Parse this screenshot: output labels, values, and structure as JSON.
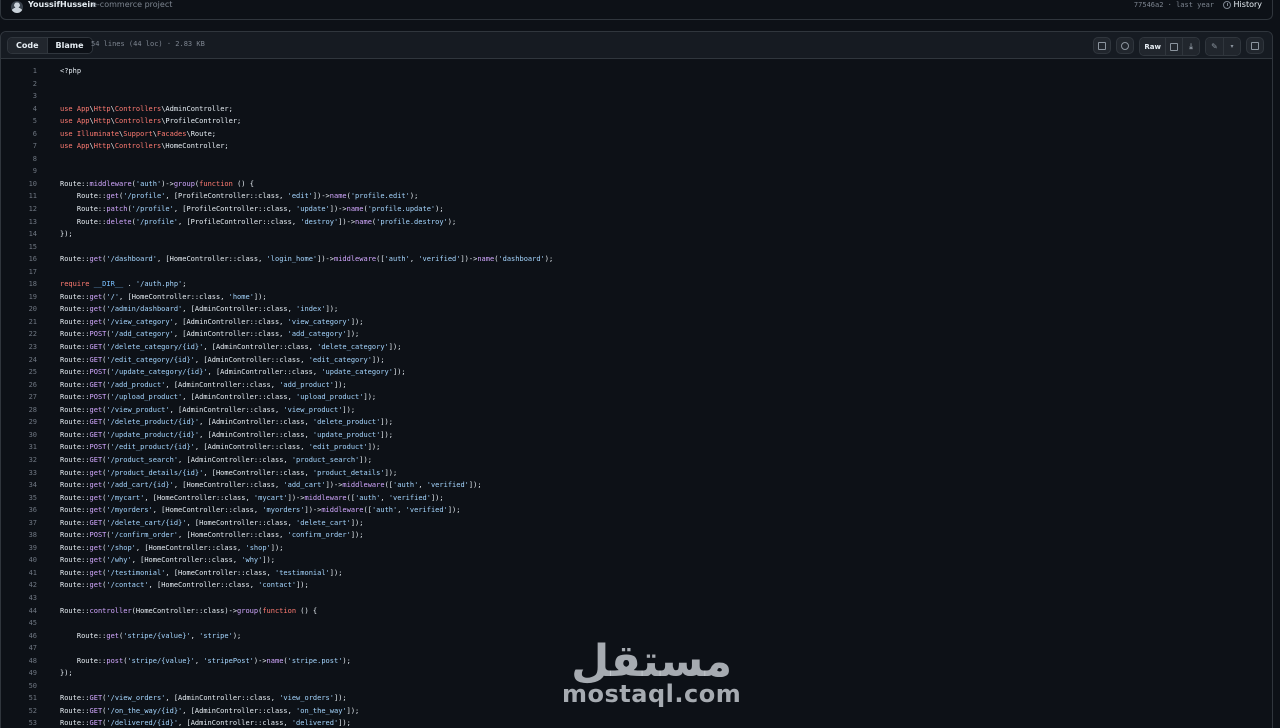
{
  "commit": {
    "author": "YoussifHussein",
    "message": "e-commerce project",
    "sha_time": "77546a2 · last year",
    "history_label": "History"
  },
  "file": {
    "code_tab": "Code",
    "blame_tab": "Blame",
    "meta": "54 lines (44 loc) · 2.83 KB",
    "raw_label": "Raw"
  },
  "lines": [
    "<?php",
    "",
    "",
    "use App\\Http\\Controllers\\AdminController;",
    "use App\\Http\\Controllers\\ProfileController;",
    "use Illuminate\\Support\\Facades\\Route;",
    "use App\\Http\\Controllers\\HomeController;",
    "",
    "",
    "Route::middleware('auth')->group(function () {",
    "    Route::get('/profile', [ProfileController::class, 'edit'])->name('profile.edit');",
    "    Route::patch('/profile', [ProfileController::class, 'update'])->name('profile.update');",
    "    Route::delete('/profile', [ProfileController::class, 'destroy'])->name('profile.destroy');",
    "});",
    "",
    "Route::get('/dashboard', [HomeController::class, 'login_home'])->middleware(['auth', 'verified'])->name('dashboard');",
    "",
    "require __DIR__ . '/auth.php';",
    "Route::get('/', [HomeController::class, 'home']);",
    "Route::get('/admin/dashboard', [AdminController::class, 'index']);",
    "Route::get('/view_category', [AdminController::class, 'view_category']);",
    "Route::POST('/add_category', [AdminController::class, 'add_category']);",
    "Route::GET('/delete_category/{id}', [AdminController::class, 'delete_category']);",
    "Route::GET('/edit_category/{id}', [AdminController::class, 'edit_category']);",
    "Route::POST('/update_category/{id}', [AdminController::class, 'update_category']);",
    "Route::GET('/add_product', [AdminController::class, 'add_product']);",
    "Route::POST('/upload_product', [AdminController::class, 'upload_product']);",
    "Route::get('/view_product', [AdminController::class, 'view_product']);",
    "Route::GET('/delete_product/{id}', [AdminController::class, 'delete_product']);",
    "Route::GET('/update_product/{id}', [AdminController::class, 'update_product']);",
    "Route::POST('/edit_product/{id}', [AdminController::class, 'edit_product']);",
    "Route::GET('/product_search', [AdminController::class, 'product_search']);",
    "Route::get('/product_details/{id}', [HomeController::class, 'product_details']);",
    "Route::get('/add_cart/{id}', [HomeController::class, 'add_cart'])->middleware(['auth', 'verified']);",
    "Route::get('/mycart', [HomeController::class, 'mycart'])->middleware(['auth', 'verified']);",
    "Route::get('/myorders', [HomeController::class, 'myorders'])->middleware(['auth', 'verified']);",
    "Route::GET('/delete_cart/{id}', [HomeController::class, 'delete_cart']);",
    "Route::POST('/confirm_order', [HomeController::class, 'confirm_order']);",
    "Route::get('/shop', [HomeController::class, 'shop']);",
    "Route::get('/why', [HomeController::class, 'why']);",
    "Route::get('/testimonial', [HomeController::class, 'testimonial']);",
    "Route::get('/contact', [HomeController::class, 'contact']);",
    "",
    "Route::controller(HomeController::class)->group(function () {",
    "",
    "    Route::get('stripe/{value}', 'stripe');",
    "",
    "    Route::post('stripe/{value}', 'stripePost')->name('stripe.post');",
    "});",
    "",
    "Route::GET('/view_orders', [AdminController::class, 'view_orders']);",
    "Route::GET('/on_the_way/{id}', [AdminController::class, 'on_the_way']);",
    "Route::GET('/delivered/{id}', [AdminController::class, 'delivered']);"
  ],
  "watermark": {
    "arabic": "مستقل",
    "latin": "mostaql.com"
  }
}
